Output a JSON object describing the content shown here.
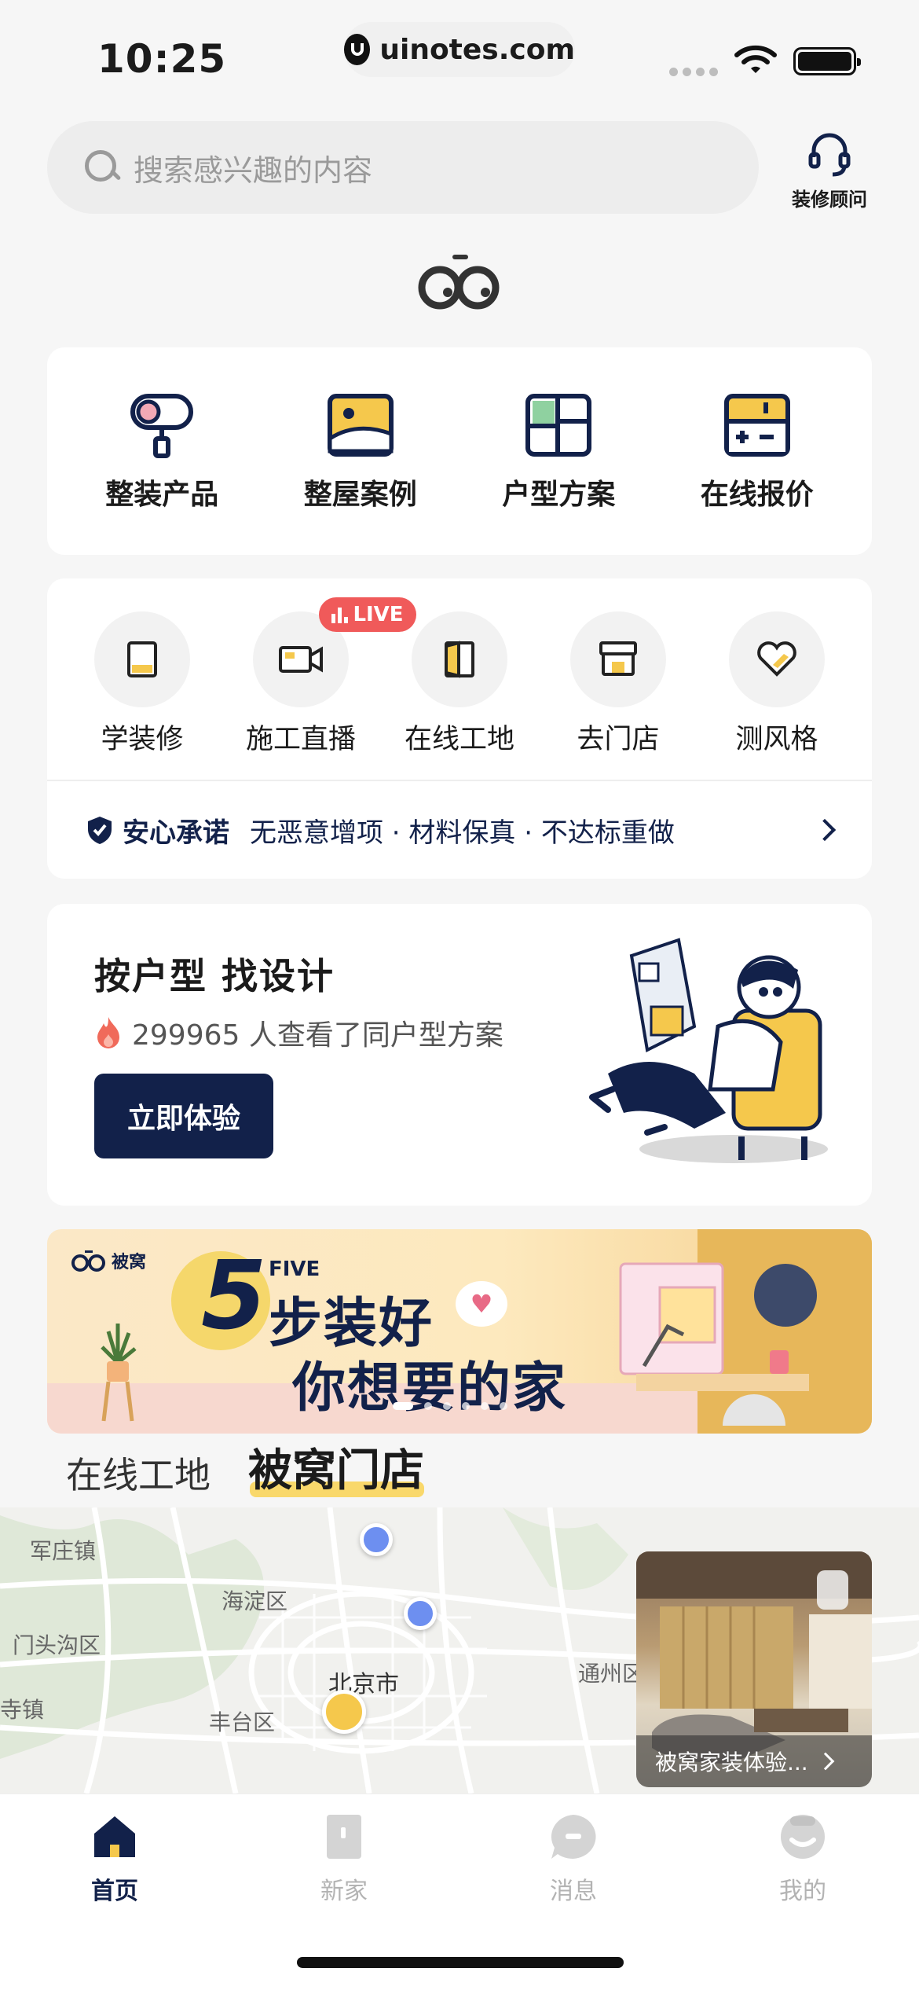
{
  "status_bar": {
    "time": "10:25",
    "url": "uinotes.com"
  },
  "search": {
    "placeholder": "搜索感兴趣的内容"
  },
  "advisor": {
    "label": "装修顾问"
  },
  "categories": [
    {
      "label": "整装产品",
      "icon": "paint-roller-icon"
    },
    {
      "label": "整屋案例",
      "icon": "picture-icon"
    },
    {
      "label": "户型方案",
      "icon": "floorplan-icon"
    },
    {
      "label": "在线报价",
      "icon": "calculator-icon"
    }
  ],
  "tools": [
    {
      "label": "学装修",
      "icon": "book-icon"
    },
    {
      "label": "施工直播",
      "icon": "video-camera-icon",
      "badge": "LIVE"
    },
    {
      "label": "在线工地",
      "icon": "door-icon"
    },
    {
      "label": "去门店",
      "icon": "store-icon"
    },
    {
      "label": "测风格",
      "icon": "heart-icon"
    }
  ],
  "promise": {
    "title": "安心承诺",
    "text": "无恶意增项 · 材料保真 · 不达标重做"
  },
  "design": {
    "title": "按户型 找设计",
    "subtitle": "299965 人查看了同户型方案",
    "button": "立即体验"
  },
  "banner": {
    "brand": "被窝",
    "number": "5",
    "five_word": "FIVE",
    "line1": "步装好",
    "line2": "你想要的家",
    "page_count": 6,
    "active_page": 1
  },
  "store_tabs": [
    {
      "label": "在线工地",
      "active": false
    },
    {
      "label": "被窝门店",
      "active": true
    }
  ],
  "map": {
    "labels": [
      "军庄镇",
      "海淀区",
      "门头沟区",
      "北京市",
      "丰台区",
      "通州区",
      "寺镇"
    ]
  },
  "store_card": {
    "caption": "被窝家装体验..."
  },
  "nav": [
    {
      "label": "首页",
      "icon": "home-icon",
      "active": true
    },
    {
      "label": "新家",
      "icon": "door-icon",
      "active": false
    },
    {
      "label": "消息",
      "icon": "message-icon",
      "active": false
    },
    {
      "label": "我的",
      "icon": "profile-icon",
      "active": false
    }
  ],
  "colors": {
    "navy": "#12214a",
    "accent_yellow": "#f5c84c",
    "live_red": "#f05a5a",
    "pin_blue": "#6d8ff0"
  }
}
